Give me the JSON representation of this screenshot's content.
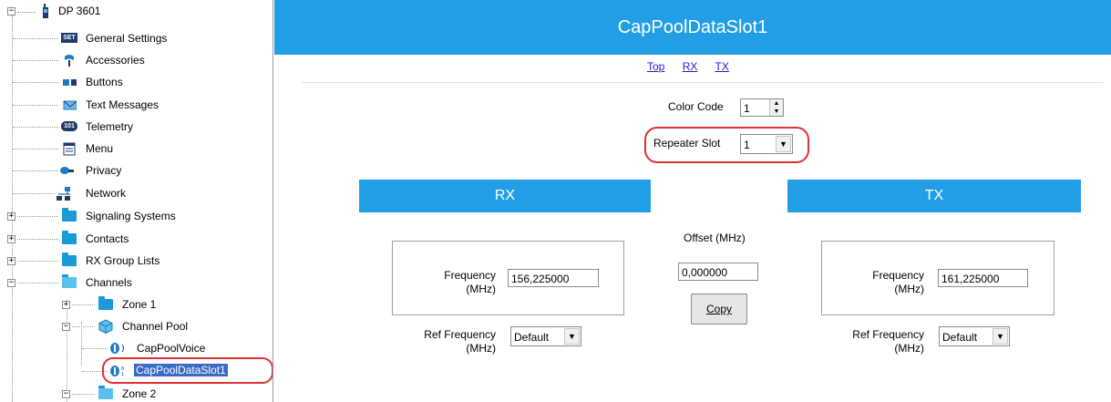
{
  "tree": {
    "root": "DP 3601",
    "items": [
      {
        "label": "General Settings",
        "icon": "settings-icon"
      },
      {
        "label": "Accessories",
        "icon": "accessories-icon"
      },
      {
        "label": "Buttons",
        "icon": "buttons-icon"
      },
      {
        "label": "Text Messages",
        "icon": "envelope-icon"
      },
      {
        "label": "Telemetry",
        "icon": "telemetry-icon"
      },
      {
        "label": "Menu",
        "icon": "menu-icon"
      },
      {
        "label": "Privacy",
        "icon": "key-icon"
      },
      {
        "label": "Network",
        "icon": "network-icon"
      },
      {
        "label": "Signaling Systems",
        "icon": "folder-icon"
      },
      {
        "label": "Contacts",
        "icon": "folder-icon"
      },
      {
        "label": "RX Group Lists",
        "icon": "folder-icon"
      },
      {
        "label": "Channels",
        "icon": "folder-open-icon"
      },
      {
        "label": "Zone 1",
        "icon": "folder-icon"
      },
      {
        "label": "Channel Pool",
        "icon": "cube-icon"
      },
      {
        "label": "CapPoolVoice",
        "icon": "voice-channel-icon"
      },
      {
        "label": "CapPoolDataSlot1",
        "icon": "data-channel-icon"
      },
      {
        "label": "Zone 2",
        "icon": "folder-icon"
      }
    ],
    "settings_badge": "SET",
    "telemetry_badge": "101"
  },
  "header": {
    "title": "CapPoolDataSlot1"
  },
  "nav": {
    "top": "Top",
    "rx": "RX",
    "tx": "TX"
  },
  "color_code": {
    "label": "Color Code",
    "value": "1"
  },
  "repeater_slot": {
    "label": "Repeater Slot",
    "value": "1"
  },
  "rx": {
    "title": "RX",
    "frequency_label": "Frequency",
    "frequency_unit": "(MHz)",
    "frequency_value": "156,225000",
    "ref_label": "Ref Frequency",
    "ref_unit": "(MHz)",
    "ref_value": "Default"
  },
  "offset": {
    "label": "Offset (MHz)",
    "value": "0,000000",
    "copy_label": "Copy"
  },
  "tx": {
    "title": "TX",
    "frequency_label": "Frequency",
    "frequency_unit": "(MHz)",
    "frequency_value": "161,225000",
    "ref_label": "Ref Frequency",
    "ref_unit": "(MHz)",
    "ref_value": "Default"
  },
  "colors": {
    "accent": "#229ee6",
    "highlight": "#e03030",
    "selection": "#3a6bc4"
  }
}
